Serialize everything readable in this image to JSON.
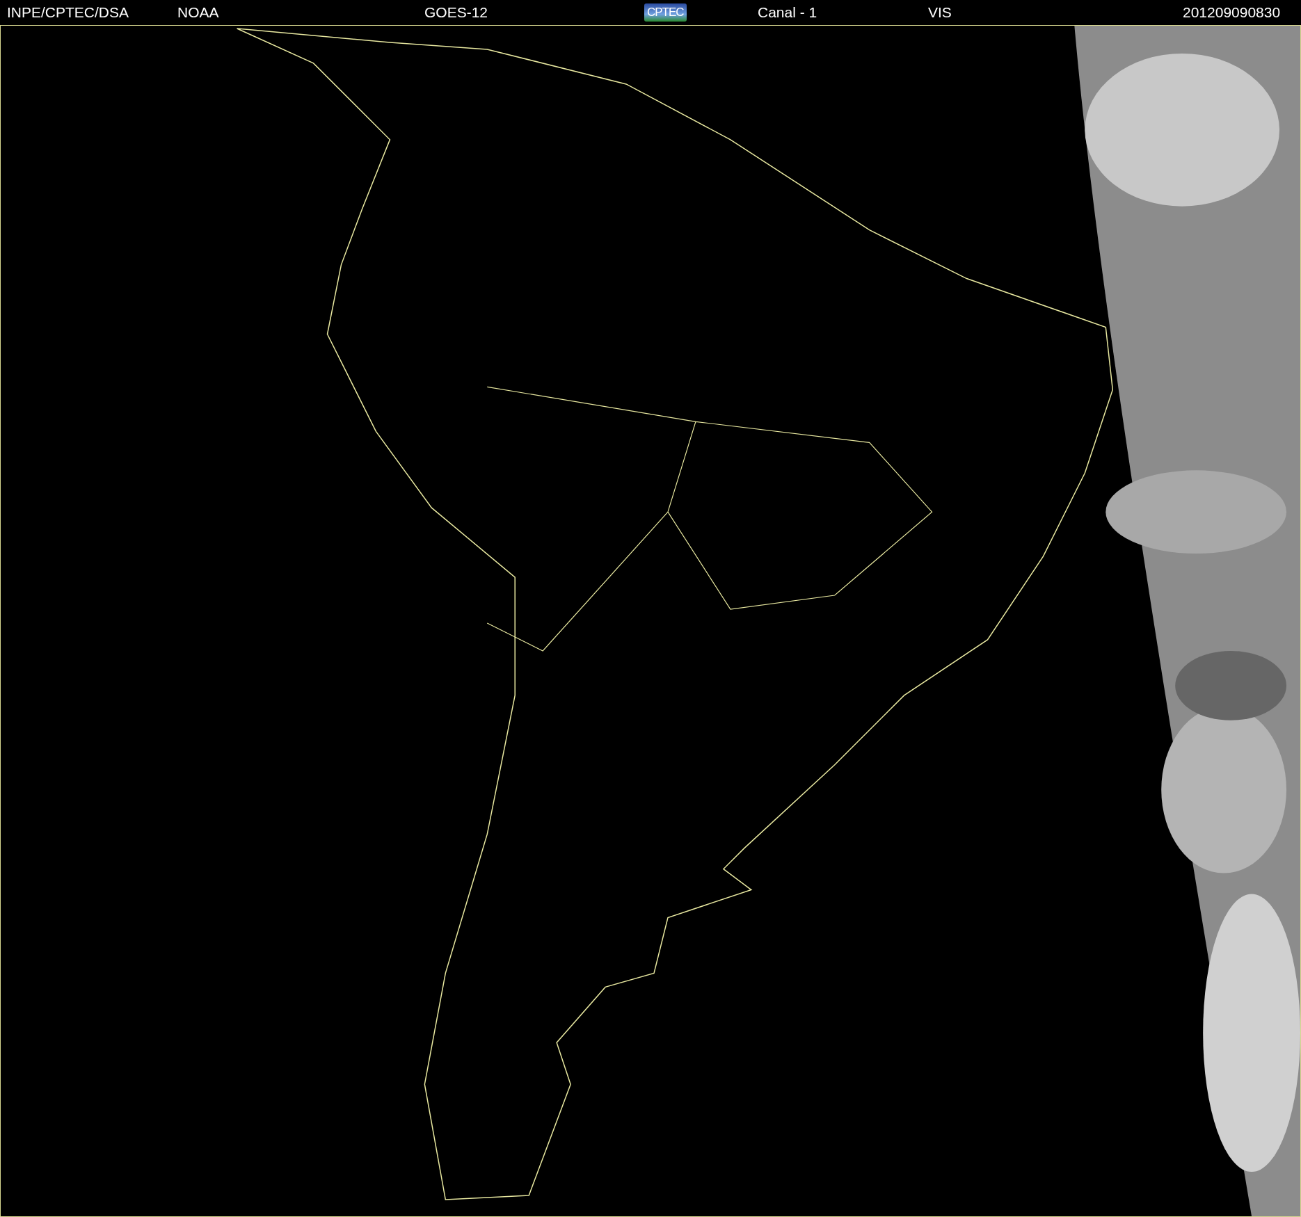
{
  "header": {
    "items": [
      {
        "kind": "text",
        "label": "INPE/CPTEC/DSA"
      },
      {
        "kind": "text",
        "label": "NOAA"
      },
      {
        "kind": "text",
        "label": "GOES-12"
      },
      {
        "kind": "logo",
        "label": "CPTEC"
      },
      {
        "kind": "text",
        "label": "Canal - 1"
      },
      {
        "kind": "text",
        "label": "VIS"
      },
      {
        "kind": "text",
        "label": "201209090830"
      }
    ]
  }
}
